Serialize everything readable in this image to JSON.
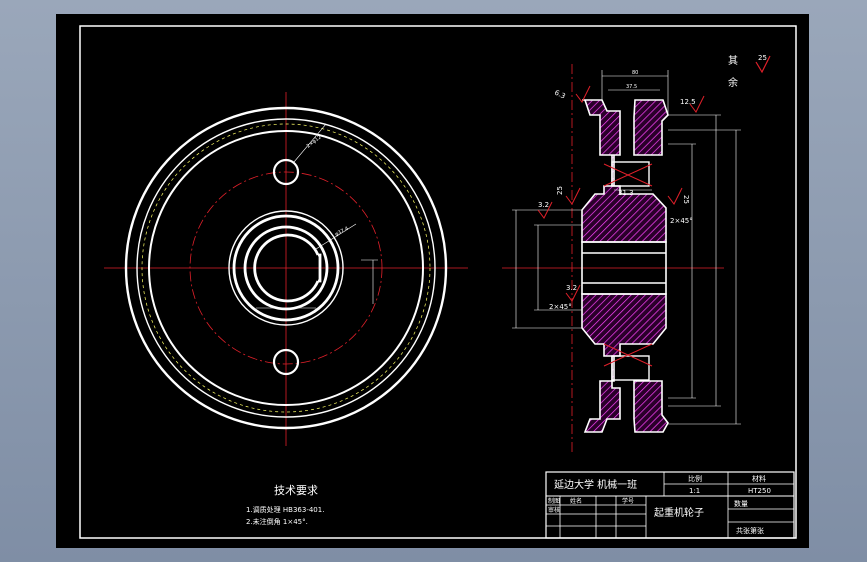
{
  "colors": {
    "viewport_bg": "#8c9aae",
    "paper": "#000000",
    "line": "#ffffff",
    "center_line": "#e0202a",
    "hatch": "#ff44ff",
    "hidden_line": "#ffff66"
  },
  "roughness": {
    "other_label_1": "其",
    "other_label_2": "余",
    "other_value": "25",
    "r_12_5": "12.5",
    "r_3_2_a": "3.2",
    "r_3_2_b": "3.2",
    "r_25_a": "25",
    "r_25_b": "25",
    "r_6_3": "6.3"
  },
  "dimensions": {
    "hole_dia": "2×φ12",
    "bore_dia": "φ37.4",
    "width_31_3": "31.3",
    "chamfer_a": "2×45°",
    "chamfer_b": "2×45°",
    "top_a": "80",
    "top_b": "37.5"
  },
  "tech_req": {
    "title": "技术要求",
    "line1": "1.调质处理 HB363-401.",
    "line2": "2.未注倒角 1×45°."
  },
  "title_block": {
    "school": "延边大学 机械一班",
    "scale_label": "比例",
    "material_label": "材料",
    "scale_value": "1:1",
    "material_value": "HT250",
    "drawing_label": "制图",
    "name_label": "姓名",
    "date_label": "学号",
    "check_label": "审核",
    "quantity_label": "数量",
    "part_name": "起重机轮子",
    "sheet_label": "共张第张"
  }
}
